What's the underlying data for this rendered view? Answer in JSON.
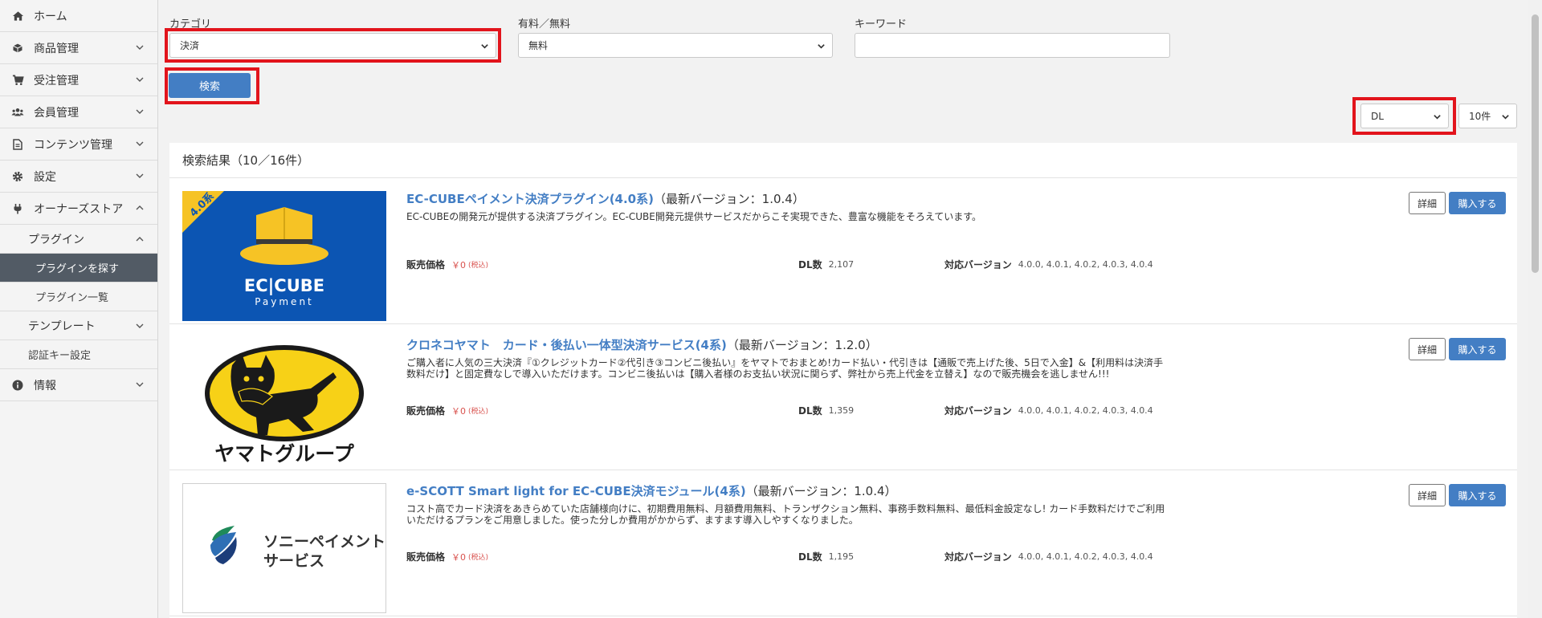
{
  "sidebar": {
    "home": "ホーム",
    "products": "商品管理",
    "orders": "受注管理",
    "members": "会員管理",
    "contents": "コンテンツ管理",
    "settings": "設定",
    "owners_store": "オーナーズストア",
    "plugins": "プラグイン",
    "find_plugins": "プラグインを探す",
    "plugin_list": "プラグイン一覧",
    "templates": "テンプレート",
    "auth_key": "認証キー設定",
    "info": "情報"
  },
  "filters": {
    "category_label": "カテゴリ",
    "category_value": "決済",
    "price_label": "有料／無料",
    "price_value": "無料",
    "keyword_label": "キーワード",
    "keyword_value": "",
    "search_button": "検索",
    "sort_value": "DL",
    "per_page_value": "10件"
  },
  "results": {
    "header": "検索結果（10／16件）",
    "price_label": "販売価格",
    "dl_label": "DL数",
    "version_label": "対応バージョン",
    "tax_label": "(税込)",
    "detail_button": "詳細",
    "buy_button": "購入する",
    "items": [
      {
        "name": "EC-CUBEペイメント決済プラグイン(4.0系)",
        "version": "（最新バージョン：1.0.4）",
        "description": "EC-CUBEの開発元が提供する決済プラグイン。EC-CUBE開発元提供サービスだからこそ実現できた、豊富な機能をそろえています。",
        "price": "￥0",
        "dl": "2,107",
        "versions": "4.0.0, 4.0.1, 4.0.2, 4.0.3, 4.0.4",
        "thumb_badge": "4.0系",
        "thumb_logo": "EC|CUBE",
        "thumb_sub": "Payment"
      },
      {
        "name": "クロネコヤマト　カード・後払い一体型決済サービス(4系)",
        "version": "（最新バージョン：1.2.0）",
        "description": "ご購入者に人気の三大決済『①クレジットカード②代引き③コンビニ後払い』をヤマトでおまとめ!カード払い・代引きは【通販で売上げた後、5日で入金】&【利用料は決済手数料だけ】と固定費なしで導入いただけます。コンビニ後払いは【購入者様のお支払い状況に関らず、弊社から売上代金を立替え】なので販売機会を逃しません!!!",
        "price": "￥0",
        "dl": "1,359",
        "versions": "4.0.0, 4.0.1, 4.0.2, 4.0.3, 4.0.4",
        "thumb_caption": "ヤマトグループ"
      },
      {
        "name": "e-SCOTT Smart light for EC-CUBE決済モジュール(4系)",
        "version": "（最新バージョン：1.0.4）",
        "description": "コスト高でカード決済をあきらめていた店舗様向けに、初期費用無料、月額費用無料、トランザクション無料、事務手数料無料、最低料金設定なし! カード手数料だけでご利用いただけるプランをご用意しました。使った分しか費用がかからず、ますます導入しやすくなりました。",
        "price": "￥0",
        "dl": "1,195",
        "versions": "4.0.0, 4.0.1, 4.0.2, 4.0.3, 4.0.4",
        "thumb_line1": "ソニーペイメント",
        "thumb_line2": "サービス"
      }
    ]
  },
  "colors": {
    "accent": "#437ec4",
    "highlight": "#e2141c",
    "active_nav": "#525b65"
  }
}
